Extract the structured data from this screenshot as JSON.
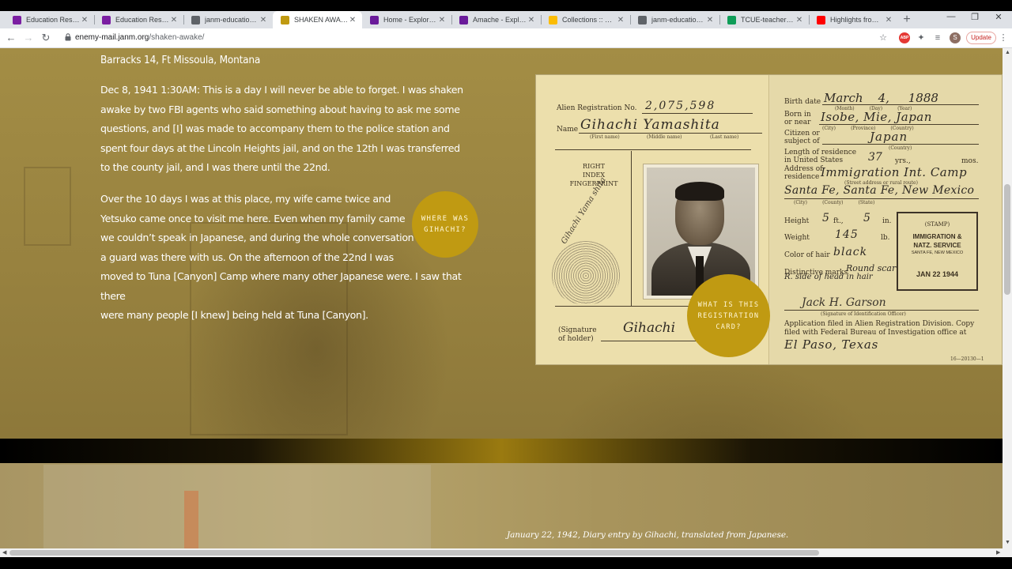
{
  "browser": {
    "tabs": [
      {
        "title": "Education Resource",
        "icon": "janm-icon",
        "color": "#7b1fa2"
      },
      {
        "title": "Education Resource",
        "icon": "janm-icon",
        "color": "#7b1fa2"
      },
      {
        "title": "janm-education-res",
        "icon": "globe-icon",
        "color": "#5f6368"
      },
      {
        "title": "SHAKEN AWAKE | 1",
        "icon": "enemy-mail-icon",
        "color": "#c09a12",
        "active": true
      },
      {
        "title": "Home - Exploring A",
        "icon": "flag-icon",
        "color": "#6a1b9a"
      },
      {
        "title": "Amache - Exploring",
        "icon": "flag-icon",
        "color": "#6a1b9a"
      },
      {
        "title": "Collections :: Docu",
        "icon": "drive-icon",
        "color": "#fbbc04"
      },
      {
        "title": "janm-education-res",
        "icon": "globe-icon",
        "color": "#5f6368"
      },
      {
        "title": "TCUE-teachersGuid",
        "icon": "doc-icon",
        "color": "#0f9d58"
      },
      {
        "title": "Highlights from \"C",
        "icon": "youtube-icon",
        "color": "#ff0000"
      }
    ],
    "url_domain": "enemy-mail.janm.org",
    "url_path": "/shaken-awake/",
    "update_label": "Update",
    "avatar_letter": "S",
    "abp_label": "ABP"
  },
  "content": {
    "heading": "Barracks 14, Ft Missoula, Montana",
    "para1": "Dec 8, 1941 1:30AM: This is a day I will never be able to forget. I was shaken awake by two FBI agents who said something about having to ask me some questions, and [I] was made to accompany them to the police station and spent four days at the Lincoln Heights jail, and on the 12th I was transferred to the county jail, and I was there until the 22nd.",
    "para2_lines": [
      "Over the 10 days I was at this place, my wife came twice and",
      "Yetsuko came once to visit me here. Even when my family came",
      "we couldn’t speak in Japanese, and during the whole conversation",
      "a guard was there with us. On the afternoon of the 22nd I was",
      "moved to Tuna [Canyon] Camp where many other Japanese were. I saw that there",
      "were many people [I knew] being held at Tuna [Canyon]."
    ],
    "bubble_where": [
      "Where was",
      "Gihachi?"
    ],
    "bubble_what": [
      "What is this",
      "registration",
      "card?"
    ],
    "caption": "January 22, 1942, Diary entry by Gihachi, translated from Japanese."
  },
  "card": {
    "reg_label": "Alien Registration No.",
    "reg_no": "2,075,598",
    "name_label": "Name",
    "name_value": "Gihachi  Yamashita",
    "first_name": "(First name)",
    "middle_name": "(Middle name)",
    "last_name": "(Last name)",
    "fingerprint_label": "RIGHT\nINDEX FINGERPRINT",
    "signature_label": "(Signature\nof holder)",
    "signature_value": "Gihachi",
    "birth_label": "Birth date",
    "birth_value": "March    4,     1888",
    "month_day_year": "(Month)          (Day)          (Year)",
    "born_label": "Born in\nor near",
    "born_value": "Isobe, Mie, Japan",
    "city_prov_country": "(City)          (Province)          (Country)",
    "citizen_label": "Citizen or\nsubject of",
    "citizen_value": "Japan",
    "country_sub": "(Country)",
    "length_label": "Length of residence\nin United States",
    "length_value": "37",
    "yrs": "yrs.,",
    "mos": "mos.",
    "address_label": "Address of\nresidence",
    "address_value1": "Immigration Int. Camp",
    "address_value2": "Santa Fe, Santa Fe, New Mexico",
    "street_sub": "(Street address or rural route)",
    "city_county_state": "(City)          (County)          (State)",
    "height_label": "Height",
    "height_ft": "5",
    "height_in": "5",
    "ft": "ft.,",
    "in": "in.",
    "weight_label": "Weight",
    "weight_value": "145",
    "lb": "lb.",
    "hair_label": "Color of hair",
    "hair_value": "black",
    "marks_label": "Distinctive marks",
    "marks_value1": "Round scar",
    "marks_value2": "R. side of head in hair",
    "stamp_title": "(STAMP)",
    "stamp_org": "IMMIGRATION &\nNATZ. SERVICE",
    "stamp_place": "SANTA FE, NEW MEXICO",
    "stamp_date": "JAN 22 1944",
    "officer_sig_label": "(Signature of Identification Officer)",
    "filed_text": "Application filed in Alien Registration Division. Copy filed with Federal Bureau of Investigation office at",
    "filed_place": "El  Paso, Texas",
    "form_no": "16—20130—1"
  }
}
